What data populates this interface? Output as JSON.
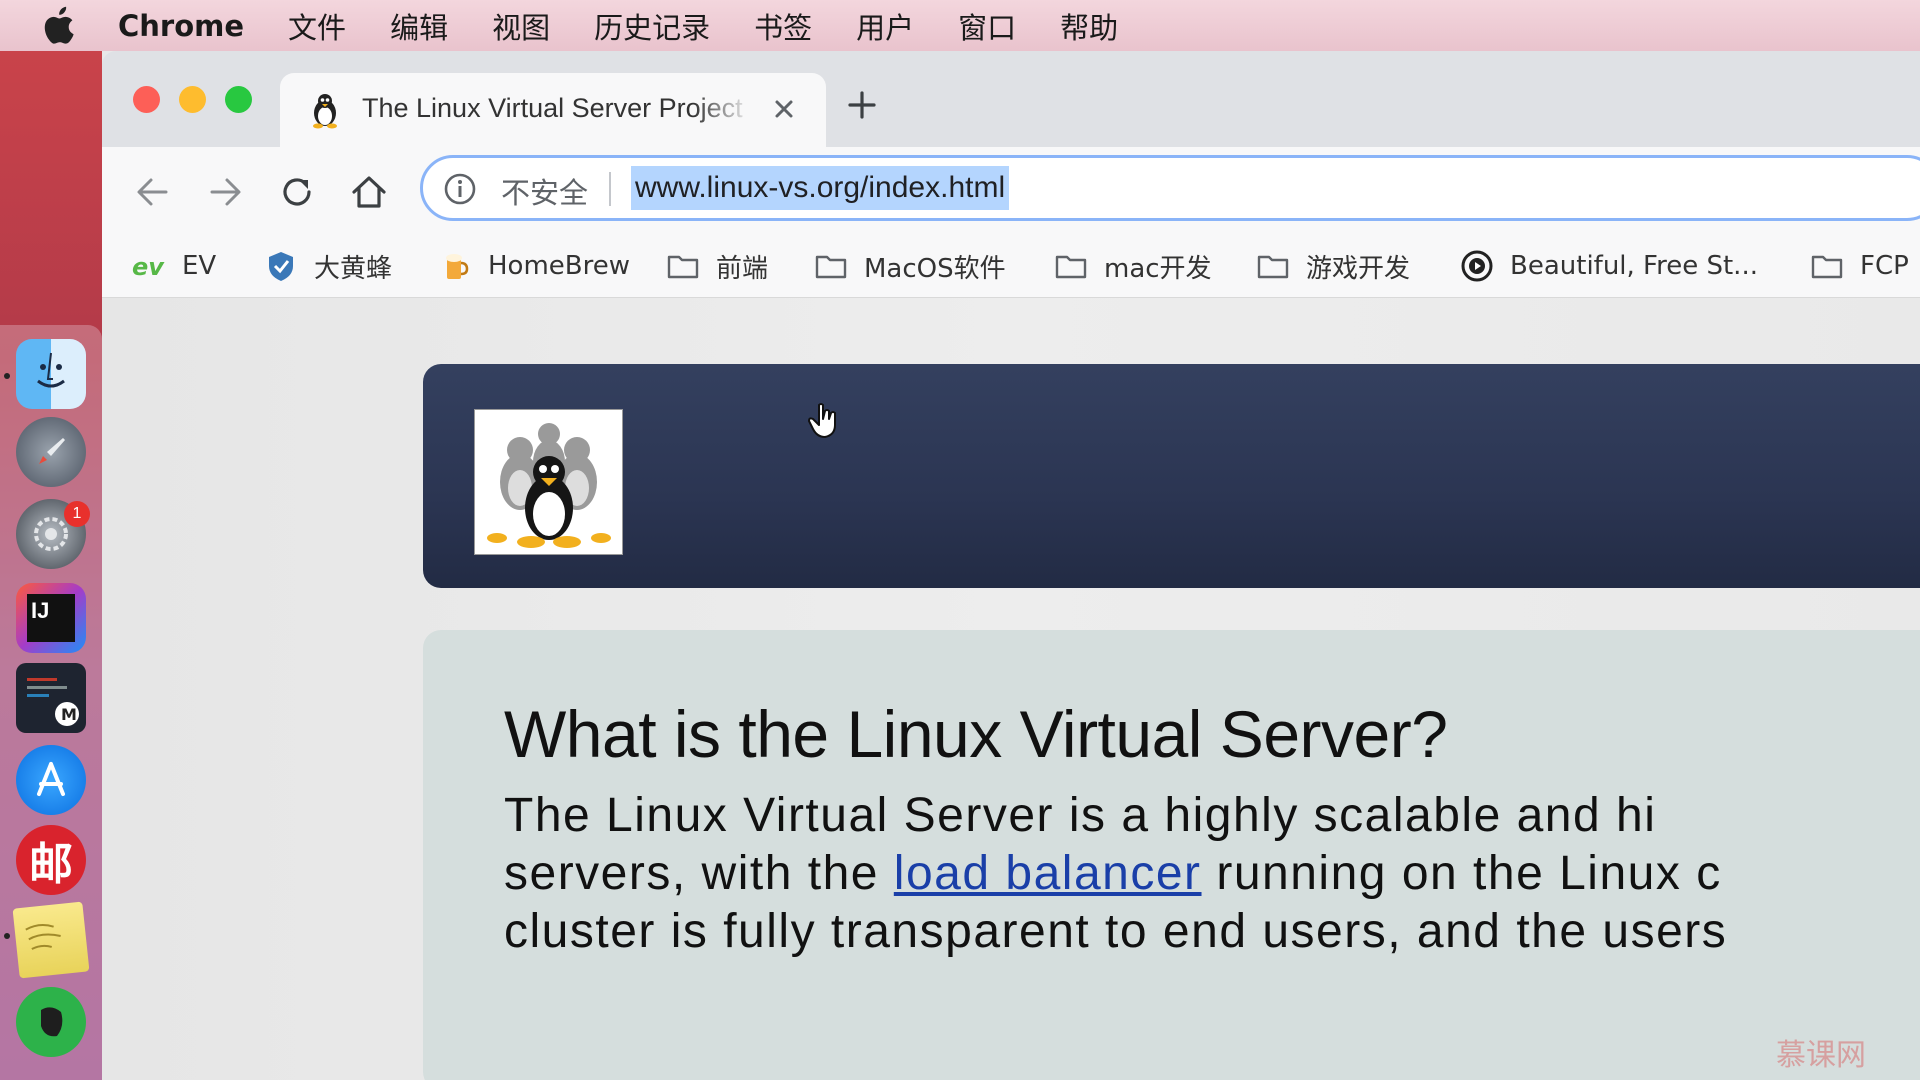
{
  "menubar": {
    "app_name": "Chrome",
    "items": [
      "文件",
      "编辑",
      "视图",
      "历史记录",
      "书签",
      "用户",
      "窗口",
      "帮助"
    ]
  },
  "tab": {
    "title": "The Linux Virtual Server Project",
    "favicon": "tux-penguin-icon"
  },
  "omnibox": {
    "security_label": "不安全",
    "url": "www.linux-vs.org/index.html"
  },
  "bookmarks": [
    {
      "label": "EV",
      "icon": "ev-logo-icon"
    },
    {
      "label": "大黄蜂",
      "icon": "shield-icon"
    },
    {
      "label": "HomeBrew",
      "icon": "beer-icon"
    },
    {
      "label": "前端",
      "icon": "folder-icon"
    },
    {
      "label": "MacOS软件",
      "icon": "folder-icon"
    },
    {
      "label": "mac开发",
      "icon": "folder-icon"
    },
    {
      "label": "游戏开发",
      "icon": "folder-icon"
    },
    {
      "label": "Beautiful, Free St...",
      "icon": "circle-play-icon"
    },
    {
      "label": "FCP",
      "icon": "folder-icon"
    }
  ],
  "dock": {
    "system_preferences_badge": "1"
  },
  "page": {
    "heading": "What is the Linux Virtual Server?",
    "para_line1": "The Linux Virtual Server is a highly scalable and hi",
    "para_line2_pre": "servers, with the ",
    "para_line2_link": "load balancer",
    "para_line2_post": " running on the Linux c",
    "para_line3": "cluster is fully transparent to end users, and the users"
  },
  "watermark": "慕课网",
  "colors": {
    "banner": "#2e3856",
    "content_bg": "#d5dedd",
    "link": "#1a3fa8",
    "url_highlight": "#b4d5fe"
  }
}
